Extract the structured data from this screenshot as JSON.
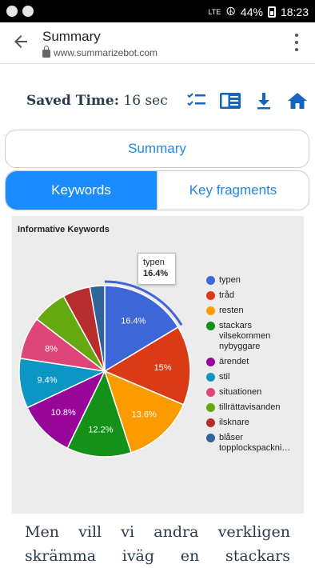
{
  "status": {
    "time": "18:23",
    "battery": "44%",
    "network": "LTE"
  },
  "appbar": {
    "title": "Summary",
    "url": "www.summarizebot.com"
  },
  "saved": {
    "label": "Saved Time:",
    "value": "16 sec"
  },
  "buttons": {
    "summary": "Summary"
  },
  "tabs": [
    {
      "label": "Keywords"
    },
    {
      "label": "Key fragments"
    }
  ],
  "chart_title": "Informative Keywords",
  "tooltip": {
    "name": "typen",
    "value": "16.4%"
  },
  "chart_data": {
    "type": "pie",
    "title": "Informative Keywords",
    "slices": [
      {
        "label": "typen",
        "value": 16.4,
        "color": "#3d66d6",
        "text": "16.4%"
      },
      {
        "label": "tråd",
        "value": 15.0,
        "color": "#db3a16",
        "text": "15%"
      },
      {
        "label": "resten",
        "value": 13.6,
        "color": "#fb9b00",
        "text": "13.6%"
      },
      {
        "label": "stackars vilsekommen nybyggare",
        "value": 12.2,
        "color": "#139119",
        "text": "12.2%"
      },
      {
        "label": "ärendet",
        "value": 10.8,
        "color": "#980799",
        "text": "10.8%"
      },
      {
        "label": "stil",
        "value": 9.4,
        "color": "#0b97c4",
        "text": "9.4%"
      },
      {
        "label": "situationen",
        "value": 8.0,
        "color": "#de467a",
        "text": "8%"
      },
      {
        "label": "tillrättavisanden",
        "value": 6.6,
        "color": "#64a90f",
        "text": ""
      },
      {
        "label": "ilsknare",
        "value": 5.2,
        "color": "#b72d2e",
        "text": ""
      },
      {
        "label": "blåser topplockspackni…",
        "value": 2.8,
        "color": "#2f6497",
        "text": ""
      }
    ],
    "legend_position": "right"
  },
  "legend": [
    {
      "label": "typen",
      "color": "#3d66d6"
    },
    {
      "label": "tråd",
      "color": "#db3a16"
    },
    {
      "label": "resten",
      "color": "#fb9b00"
    },
    {
      "label": "stackars vilsekommen nybyggare",
      "color": "#139119"
    },
    {
      "label": "ärendet",
      "color": "#980799"
    },
    {
      "label": "stil",
      "color": "#0b97c4"
    },
    {
      "label": "situationen",
      "color": "#de467a"
    },
    {
      "label": "tillrättavisanden",
      "color": "#64a90f"
    },
    {
      "label": "ilsknare",
      "color": "#b72d2e"
    },
    {
      "label": "blåser topplockspackni…",
      "color": "#2f6497"
    }
  ],
  "body_text": "Men vill vi andra verkligen skrämma iväg en stackars"
}
